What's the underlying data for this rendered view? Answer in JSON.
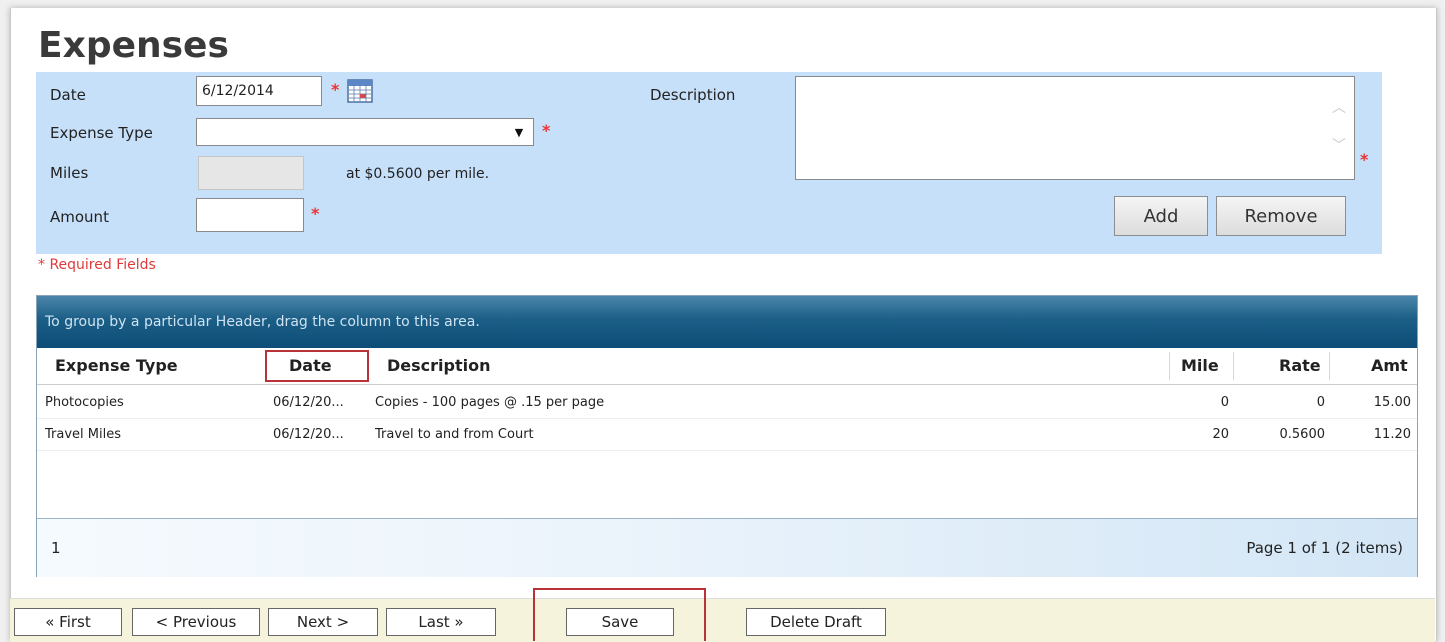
{
  "page": {
    "title": "Expenses"
  },
  "form": {
    "date_label": "Date",
    "date_value": "6/12/2014",
    "expense_type_label": "Expense Type",
    "expense_type_value": "",
    "miles_label": "Miles",
    "miles_rate_text": "at $0.5600 per mile.",
    "amount_label": "Amount",
    "amount_value": "",
    "description_label": "Description",
    "description_value": "",
    "required_mark": "*",
    "add_label": "Add",
    "remove_label": "Remove",
    "required_note": "* Required Fields"
  },
  "grid": {
    "group_hint": "To group by a particular Header, drag the column to this area.",
    "columns": [
      "Expense Type",
      "Date",
      "Description",
      "Mile",
      "Rate",
      "Amt"
    ],
    "rows": [
      {
        "type": "Photocopies",
        "date": "06/12/20...",
        "description": "Copies - 100 pages @ .15 per page",
        "mile": "0",
        "rate": "0",
        "amt": "15.00"
      },
      {
        "type": "Travel Miles",
        "date": "06/12/20...",
        "description": "Travel to and from Court",
        "mile": "20",
        "rate": "0.5600",
        "amt": "11.20"
      }
    ],
    "page_number": "1",
    "page_info": "Page 1 of 1 (2 items)"
  },
  "nav": {
    "first": "« First",
    "previous": "< Previous",
    "next": "Next >",
    "last": "Last »",
    "save": "Save",
    "delete_draft": "Delete Draft"
  },
  "colors": {
    "panel_bg": "#c7e0fa",
    "required": "#e33333",
    "highlight": "#b8323a",
    "grid_header": "#0d4d77"
  },
  "icons": {
    "calendar": "calendar-icon",
    "dropdown": "chevron-down-icon"
  }
}
